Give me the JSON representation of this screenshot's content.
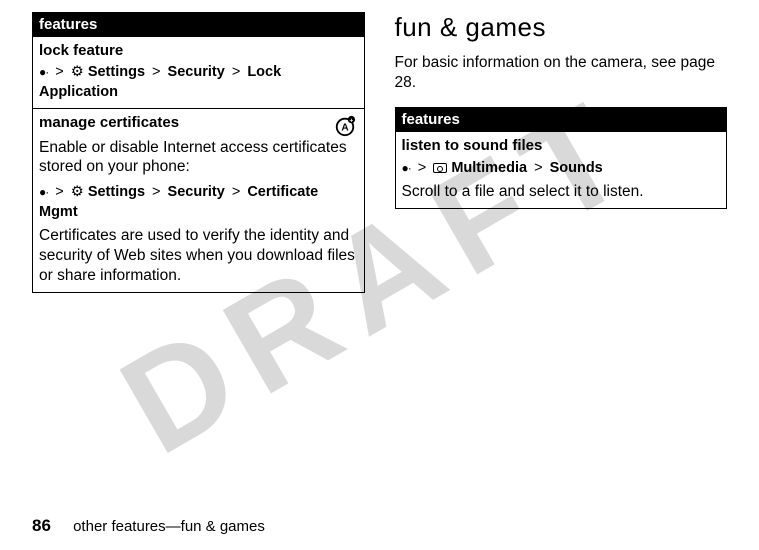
{
  "watermark": "DRAFT",
  "left_table": {
    "header": "features",
    "row1": {
      "title": "lock feature",
      "path_sep": ">",
      "settings": "Settings",
      "security": "Security",
      "lock_app": "Lock Application"
    },
    "row2": {
      "title": "manage certificates",
      "intro": "Enable or disable Internet access certificates stored on your phone:",
      "settings": "Settings",
      "security": "Security",
      "cert_mgmt": "Certificate Mgmt",
      "note": "Certificates are used to verify the identity and security of Web sites when you download files or share information."
    }
  },
  "right": {
    "heading": "fun & games",
    "intro": "For basic information on the camera, see page 28.",
    "table": {
      "header": "features",
      "row1": {
        "title": "listen to sound files",
        "multimedia": "Multimedia",
        "sounds": "Sounds",
        "note": "Scroll to a file and select it to listen."
      }
    }
  },
  "footer": {
    "page": "86",
    "text": "other features—fun & games"
  }
}
